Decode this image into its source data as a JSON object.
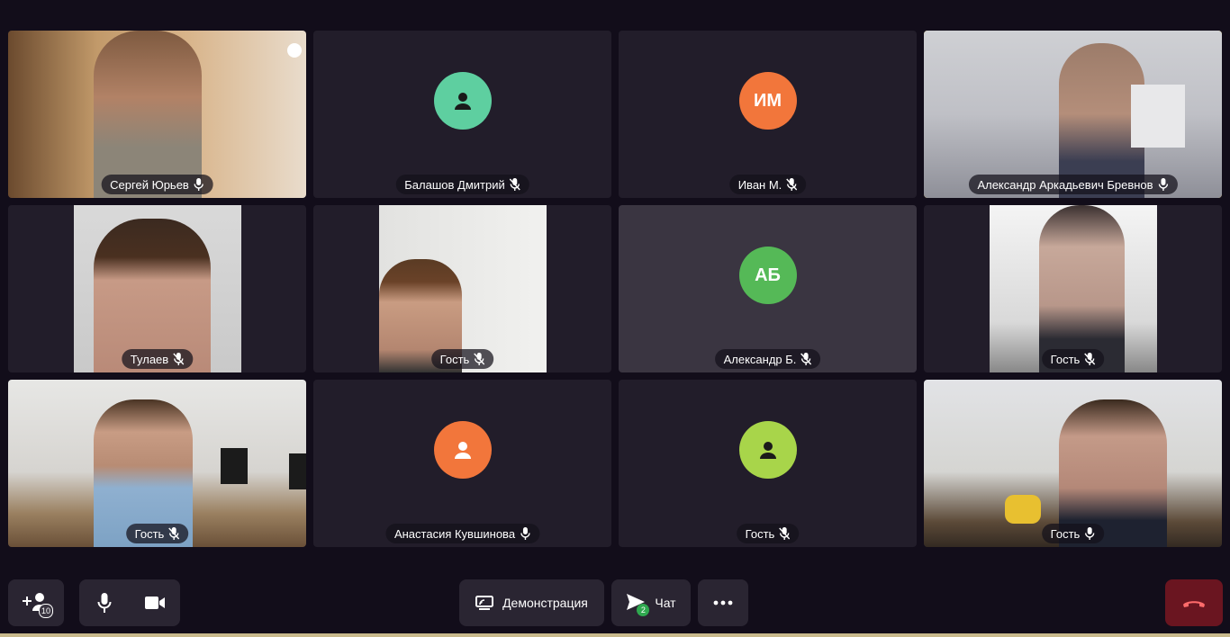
{
  "participants": [
    {
      "name": "Сергей Юрьев",
      "mic": "on",
      "view": "video",
      "hue": "warm"
    },
    {
      "name": "Балашов Дмитрий",
      "mic": "muted",
      "view": "avatar",
      "avatar_color": "#5ecfa0",
      "avatar_icon": "person-icon"
    },
    {
      "name": "Иван М.",
      "mic": "muted",
      "view": "avatar",
      "avatar_color": "#f2763b",
      "initials": "ИМ"
    },
    {
      "name": "Александр Аркадьевич Бревнов",
      "mic": "on",
      "view": "video",
      "active": true
    },
    {
      "name": "Тулаев",
      "mic": "muted",
      "view": "video-narrow"
    },
    {
      "name": "Гость",
      "mic": "muted",
      "view": "video-narrow"
    },
    {
      "name": "Александр Б.",
      "mic": "muted",
      "view": "avatar",
      "avatar_color": "#55b957",
      "initials": "АБ"
    },
    {
      "name": "Гость",
      "mic": "muted",
      "view": "video-narrow"
    },
    {
      "name": "Гость",
      "mic": "muted",
      "view": "video"
    },
    {
      "name": "Анастасия Кувшинова",
      "mic": "on",
      "view": "avatar",
      "avatar_color": "#f2763b",
      "avatar_icon": "person-icon"
    },
    {
      "name": "Гость",
      "mic": "muted",
      "view": "avatar",
      "avatar_color": "#a8d54a",
      "avatar_icon": "person-icon"
    },
    {
      "name": "Гость",
      "mic": "on",
      "view": "video"
    }
  ],
  "toolbar": {
    "invite_count": "10",
    "screen_share_label": "Демонстрация",
    "chat_label": "Чат",
    "chat_badge": "2"
  },
  "colors": {
    "background": "#120d1a",
    "tile": "#221d2a",
    "active_border": "#f5c518",
    "hangup": "#6a1520",
    "chat_badge": "#2fa84f",
    "invite_badge": "#3a3541"
  }
}
